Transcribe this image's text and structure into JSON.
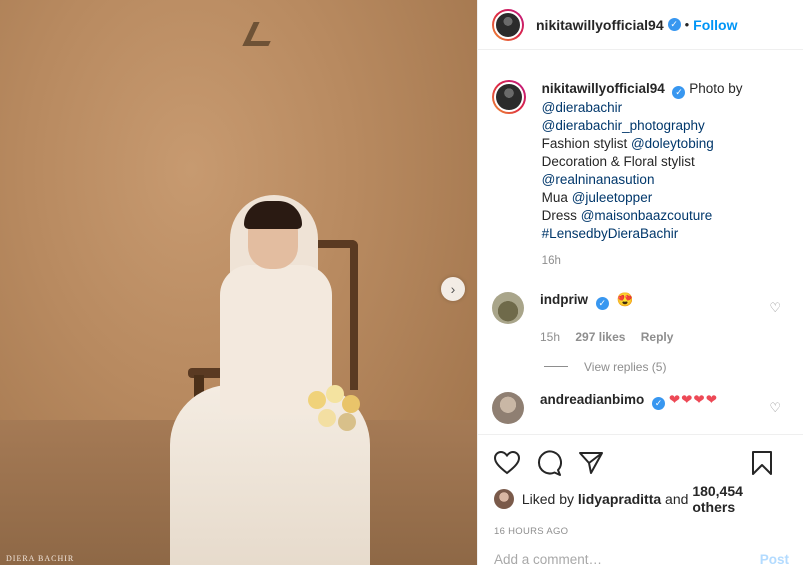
{
  "post": {
    "photo_watermark": "DIERA BACHIR",
    "next_icon": "chevron-right-icon"
  },
  "header": {
    "username": "nikitawillyofficial94",
    "separator": "•",
    "follow_label": "Follow"
  },
  "caption": {
    "username": "nikitawillyofficial94",
    "lines": [
      "Photo by",
      "@dierabachir",
      "@dierabachir_photography",
      "Fashion stylist ",
      "@doleytobing",
      "Decoration & Floral stylist",
      "@realninanasution",
      "Mua ",
      "@juleetopper",
      "Dress ",
      "@maisonbaazcouture",
      "#LensedbyDieraBachir"
    ],
    "time": "16h"
  },
  "comments": [
    {
      "username": "indpriw",
      "text": "😍",
      "time": "15h",
      "likes": "297 likes",
      "reply_label": "Reply",
      "view_replies": "View replies (5)"
    },
    {
      "username": "andreadianbimo",
      "text": "❤❤❤❤"
    }
  ],
  "actions": {
    "liked_by_prefix": "Liked by ",
    "liked_by_user": "lidyapraditta",
    "liked_by_and": " and ",
    "liked_by_count": "180,454 others",
    "time_ago": "16 HOURS AGO",
    "comment_placeholder": "Add a comment…",
    "post_label": "Post"
  },
  "colors": {
    "accent": "#0095f6",
    "verified": "#3897f0",
    "heart": "#ed4956"
  }
}
